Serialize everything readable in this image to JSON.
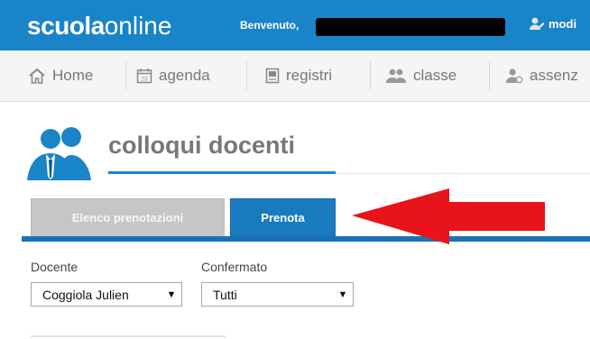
{
  "header": {
    "logo_bold": "scuola",
    "logo_light": "online",
    "welcome": "Benvenuto,",
    "user_menu_label": "modi"
  },
  "nav": {
    "items": [
      {
        "label": "Home",
        "icon": "home-icon"
      },
      {
        "label": "agenda",
        "icon": "calendar-icon"
      },
      {
        "label": "registri",
        "icon": "book-icon"
      },
      {
        "label": "classe",
        "icon": "group-icon"
      },
      {
        "label": "assenz",
        "icon": "user-absent-icon"
      }
    ]
  },
  "page": {
    "title": "colloqui docenti",
    "title_icon": "users-icon"
  },
  "tabs": [
    {
      "label": "Elenco prenotazioni",
      "active": false
    },
    {
      "label": "Prenota",
      "active": true
    }
  ],
  "filters": {
    "docente": {
      "label": "Docente",
      "value": "Coggiola Julien"
    },
    "confermato": {
      "label": "Confermato",
      "value": "Tutti"
    }
  },
  "colors": {
    "brand_blue": "#1a84c8",
    "tab_active": "#1a7ac0",
    "annotation_arrow": "#e8141a"
  }
}
